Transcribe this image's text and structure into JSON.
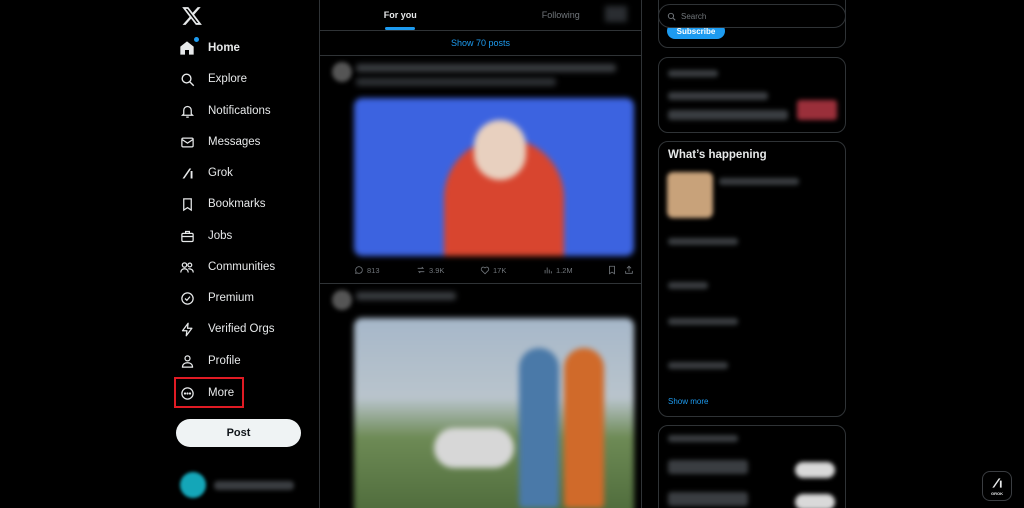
{
  "nav": {
    "items": [
      {
        "label": "Home",
        "icon": "home-icon"
      },
      {
        "label": "Explore",
        "icon": "search-icon"
      },
      {
        "label": "Notifications",
        "icon": "bell-icon"
      },
      {
        "label": "Messages",
        "icon": "envelope-icon"
      },
      {
        "label": "Grok",
        "icon": "grok-icon"
      },
      {
        "label": "Bookmarks",
        "icon": "bookmark-icon"
      },
      {
        "label": "Jobs",
        "icon": "briefcase-icon"
      },
      {
        "label": "Communities",
        "icon": "people-icon"
      },
      {
        "label": "Premium",
        "icon": "premium-icon"
      },
      {
        "label": "Verified Orgs",
        "icon": "lightning-icon"
      },
      {
        "label": "Profile",
        "icon": "person-icon"
      },
      {
        "label": "More",
        "icon": "more-circle-icon"
      }
    ],
    "post_button": "Post"
  },
  "feed": {
    "tabs": [
      "For you",
      "Following"
    ],
    "show_posts": "Show 70 posts",
    "post1_actions": {
      "replies": "813",
      "reposts": "3.9K",
      "likes": "17K",
      "views": "1.2M"
    }
  },
  "right": {
    "search_placeholder": "Search",
    "subscribe": "Subscribe",
    "trending_title": "What’s happening",
    "show_more": "Show more"
  },
  "grok_fab_label": "GROK",
  "colors": {
    "accent": "#1d9bf0",
    "highlight_box": "#e01b24",
    "background": "#000000"
  }
}
